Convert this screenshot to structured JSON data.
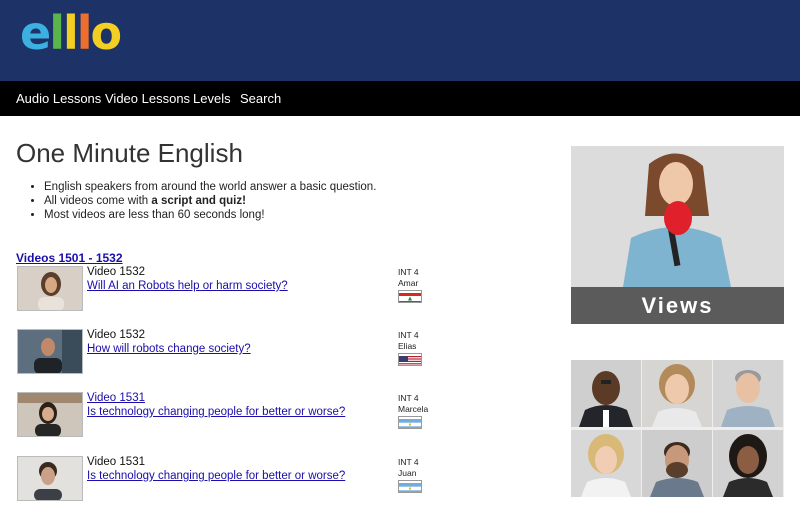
{
  "brand": {
    "logo_letters": [
      "e",
      "l",
      "l",
      "l",
      "o"
    ],
    "logo_colors": [
      "#3cb0e0",
      "#5ab54b",
      "#f2cf22",
      "#ee6f2d",
      "#f2cf22"
    ]
  },
  "nav": {
    "items": [
      "Audio Lessons",
      "Video Lessons",
      "Levels",
      "Search"
    ]
  },
  "page": {
    "title": "One Minute English",
    "bullet1": "English speakers from around the world answer a basic question.",
    "bullet2_prefix": "All videos come with ",
    "bullet2_bold": "a script and quiz!",
    "bullet3": "Most videos are less than 60 seconds long!"
  },
  "videos": {
    "range_label": "Videos 1501 - 1532",
    "items": [
      {
        "label": "Video 1532",
        "question": "Will AI an Robots help or harm society?",
        "level": "INT 4",
        "speaker": "Amar",
        "flag": "lebanon"
      },
      {
        "label": "Video 1532",
        "question": "How will robots change society?",
        "level": "INT 4",
        "speaker": "Elias",
        "flag": "usa"
      },
      {
        "label": "Video 1531",
        "question": "Is technology changing people for better or worse?",
        "level": "INT 4",
        "speaker": "Marcela",
        "flag": "argentina"
      },
      {
        "label": "Video 1531",
        "question": "Is technology changing people for better or worse?",
        "level": "INT 4",
        "speaker": "Juan",
        "flag": "argentina"
      }
    ]
  },
  "sidebar": {
    "views_label": "Views"
  },
  "colors": {
    "header_bg": "#1d3266",
    "nav_bg": "#000000",
    "link": "#1a0dab"
  }
}
